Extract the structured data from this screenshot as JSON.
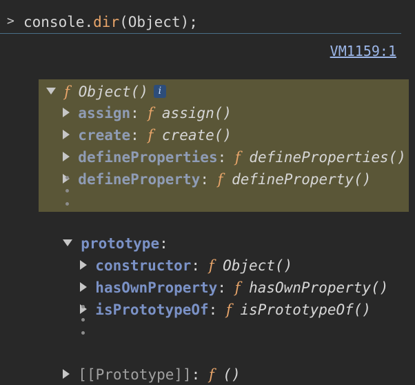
{
  "console": {
    "prompt_symbol": ">",
    "command_prefix": "console.",
    "command_method": "dir",
    "command_suffix": "(Object);"
  },
  "source_link": "VM1159:1",
  "tree": {
    "root": {
      "fn_symbol": "f",
      "signature": "Object()",
      "info_badge": "i"
    },
    "static_methods": [
      {
        "key": "assign",
        "colon": ":",
        "fn_symbol": "f",
        "signature": "assign()"
      },
      {
        "key": "create",
        "colon": ":",
        "fn_symbol": "f",
        "signature": "create()"
      },
      {
        "key": "defineProperties",
        "colon": ":",
        "fn_symbol": "f",
        "signature": "defineProperties()"
      },
      {
        "key": "defineProperty",
        "colon": ":",
        "fn_symbol": "f",
        "signature": "defineProperty()"
      }
    ],
    "prototype": {
      "key": "prototype",
      "colon": ":",
      "members": [
        {
          "key": "constructor",
          "colon": ":",
          "fn_symbol": "f",
          "signature": "Object()"
        },
        {
          "key": "hasOwnProperty",
          "colon": ":",
          "fn_symbol": "f",
          "signature": "hasOwnProperty()"
        },
        {
          "key": "isPrototypeOf",
          "colon": ":",
          "fn_symbol": "f",
          "signature": "isPrototypeOf()"
        }
      ]
    },
    "internal_proto": {
      "key": "[[Prototype]]",
      "colon": ":",
      "fn_symbol": "f",
      "signature": "()"
    }
  },
  "colors": {
    "background": "#282828",
    "highlight": "#5a5637",
    "function_marker": "#e8a56a",
    "property_key": "#7b92c7",
    "link": "#9cb6e8"
  }
}
